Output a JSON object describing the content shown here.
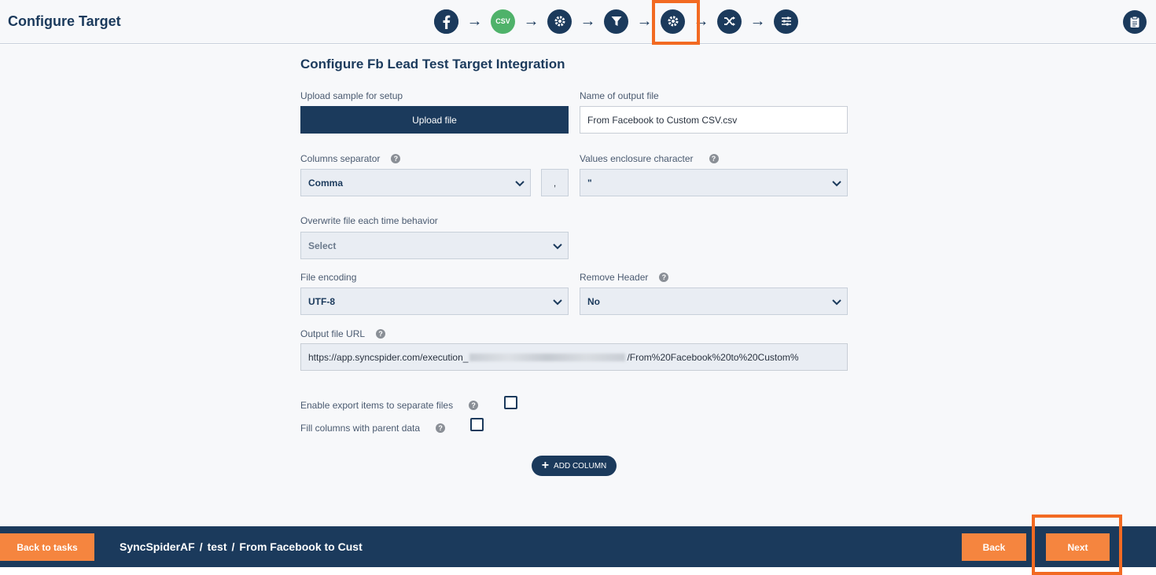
{
  "header": {
    "title": "Configure Target",
    "steps": [
      {
        "icon": "facebook-icon"
      },
      {
        "icon": "csv-icon",
        "label": "CSV"
      },
      {
        "icon": "gear-icon"
      },
      {
        "icon": "filter-icon"
      },
      {
        "icon": "gear-icon",
        "active": true
      },
      {
        "icon": "shuffle-icon"
      },
      {
        "icon": "sliders-icon"
      }
    ],
    "highlight_color": "#f26a22"
  },
  "form": {
    "title": "Configure Fb Lead Test Target Integration",
    "upload_label": "Upload sample for setup",
    "upload_button": "Upload file",
    "output_name_label": "Name of output file",
    "output_name_value": "From Facebook to Custom CSV.csv",
    "separator_label": "Columns separator",
    "separator_value": "Comma",
    "separator_char": ",",
    "enclosure_label": "Values enclosure character",
    "enclosure_value": "\"",
    "overwrite_label": "Overwrite file each time behavior",
    "overwrite_value": "Select",
    "encoding_label": "File encoding",
    "encoding_value": "UTF-8",
    "remove_header_label": "Remove Header",
    "remove_header_value": "No",
    "url_label": "Output file URL",
    "url_prefix": "https://app.syncspider.com/execution_",
    "url_suffix": "/From%20Facebook%20to%20Custom%",
    "separate_files_label": "Enable export items to separate files",
    "fill_parent_label": "Fill columns with parent data",
    "add_column_button": "ADD COLUMN"
  },
  "footer": {
    "back_to_tasks": "Back to tasks",
    "breadcrumb": [
      "SyncSpiderAF",
      "test",
      "From Facebook to Cust"
    ],
    "separator": "/",
    "back": "Back",
    "next": "Next"
  },
  "colors": {
    "primary": "#1b3a5c",
    "accent": "#f5853f",
    "csv": "#4fb26a"
  }
}
